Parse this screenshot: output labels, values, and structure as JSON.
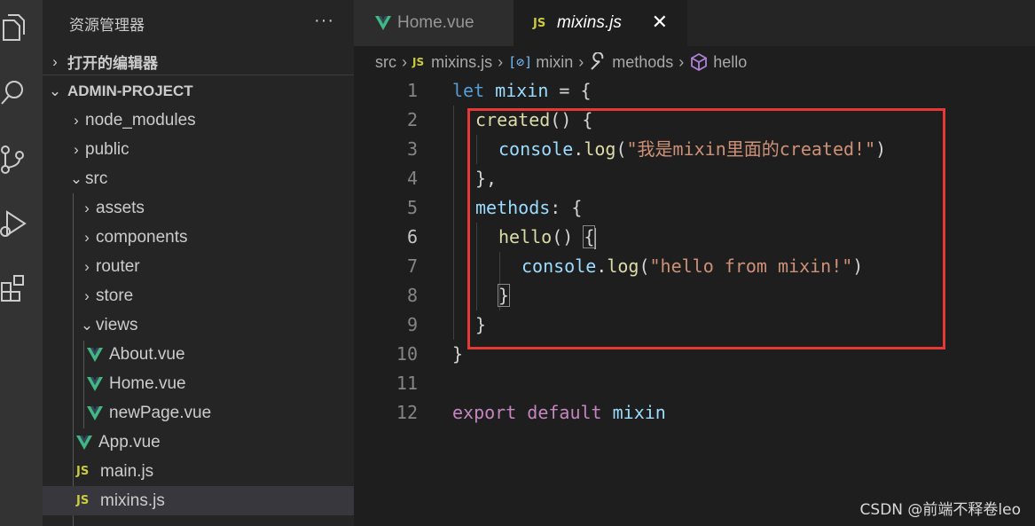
{
  "explorer": {
    "title": "资源管理器",
    "more": "···",
    "open_editors": "打开的编辑器",
    "project": "ADMIN-PROJECT",
    "tree": [
      {
        "label": "node_modules"
      },
      {
        "label": "public"
      },
      {
        "label": "src"
      },
      {
        "label": "assets"
      },
      {
        "label": "components"
      },
      {
        "label": "router"
      },
      {
        "label": "store"
      },
      {
        "label": "views"
      },
      {
        "label": "About.vue"
      },
      {
        "label": "Home.vue"
      },
      {
        "label": "newPage.vue"
      },
      {
        "label": "App.vue"
      },
      {
        "label": "main.js"
      },
      {
        "label": "mixins.js"
      }
    ],
    "js_badge": "JS"
  },
  "tabs": [
    {
      "label": "Home.vue"
    },
    {
      "label": "mixins.js",
      "close": "✕"
    }
  ],
  "breadcrumb": {
    "items": [
      "src",
      "mixins.js",
      "mixin",
      "methods",
      "hello"
    ],
    "var_icon": "[⊘]"
  },
  "editor": {
    "line_numbers": [
      "1",
      "2",
      "3",
      "4",
      "5",
      "6",
      "7",
      "8",
      "9",
      "10",
      "11",
      "12"
    ],
    "active_line": "6",
    "code": {
      "l1_kw": "let",
      "l1_var": "mixin",
      "l1_rest": " = {",
      "l2_fn": "created",
      "l2_rest": "() {",
      "l3_obj": "console",
      "l3_dot": ".",
      "l3_fn": "log",
      "l3_open": "(",
      "l3_str": "\"我是mixin里面的created!\"",
      "l3_close": ")",
      "l4": "},",
      "l5_prop": "methods",
      "l5_rest": ": {",
      "l6_fn": "hello",
      "l6_rest": "() ",
      "l6_brace": "{",
      "l7_obj": "console",
      "l7_dot": ".",
      "l7_fn": "log",
      "l7_open": "(",
      "l7_str": "\"hello from mixin!\"",
      "l7_close": ")",
      "l8": "}",
      "l9": "}",
      "l10": "}",
      "l12_kw1": "export",
      "l12_kw2": "default",
      "l12_var": "mixin"
    }
  },
  "colors": {
    "highlight_box": "#e53935",
    "vue_green": "#41b883",
    "js_yellow": "#cbcb41"
  },
  "watermark": "CSDN @前端不释卷leo"
}
